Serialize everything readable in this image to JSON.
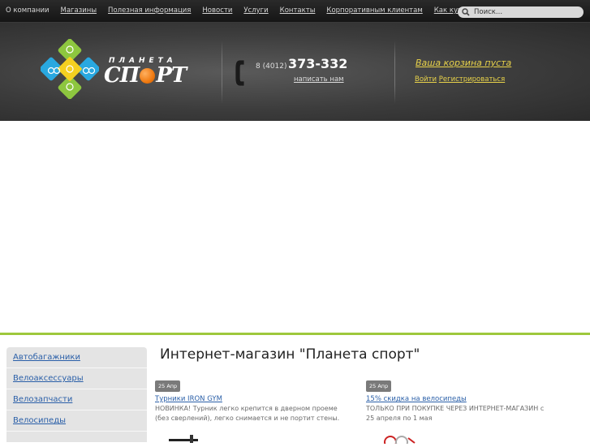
{
  "nav": {
    "items": [
      "О компании",
      "Магазины",
      "Полезная информация",
      "Новости",
      "Услуги",
      "Контакты",
      "Корпоративным клиентам",
      "Как купить?"
    ]
  },
  "search": {
    "placeholder": "Поиск..."
  },
  "logo": {
    "top": "ПЛАНЕТА",
    "main_left": "СП",
    "main_right": "РТ"
  },
  "contacts": {
    "phone_prefix": "8 (4012)",
    "phone_number": "373-332",
    "write_us": "написать нам"
  },
  "cart": {
    "status": "Ваша корзина пуста",
    "login": "Войти",
    "register": "Регистрироваться"
  },
  "sidebar": {
    "items": [
      "Автобагажники",
      "Велоаксессуары",
      "Велозапчасти",
      "Велосипеды"
    ]
  },
  "main": {
    "title": "Интернет-магазин \"Планета спорт\"",
    "news": [
      {
        "date": "25 Апр",
        "title": "Турники IRON GYM ",
        "text": "НОВИНКА! Турник легко крепится в дверном проеме (без сверлений), легко снимается и не портит стены."
      },
      {
        "date": "25 Апр",
        "title": "15% скидка на велосипеды",
        "text": "ТОЛЬКО ПРИ ПОКУПКЕ ЧЕРЕЗ ИНТЕРНЕТ-МАГАЗИН с 25 апреля по 1 мая"
      }
    ]
  },
  "colors": {
    "accent_green": "#9ec83c",
    "link_blue": "#2a5fa8",
    "cart_yellow": "#e8d24a",
    "ball_orange": "#f07a10"
  }
}
